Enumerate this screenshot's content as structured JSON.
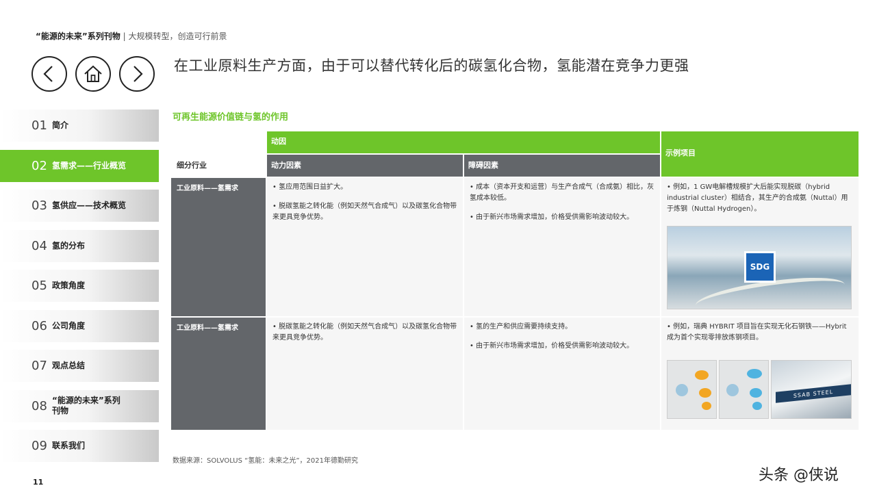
{
  "header": {
    "series_title": "“能源的未来”系列刊物",
    "series_subtitle": "| 大规模转型，创造可行前景",
    "headline": "在工业原料生产方面，由于可以替代转化后的碳氢化合物，氢能潜在竞争力更强"
  },
  "nav": {
    "back_icon": "chevron-left-icon",
    "home_icon": "home-icon",
    "forward_icon": "chevron-right-icon"
  },
  "sidebar": {
    "items": [
      {
        "num": "01",
        "label": "简介",
        "active": false
      },
      {
        "num": "02",
        "label": "氢需求——行业概览",
        "active": true
      },
      {
        "num": "03",
        "label": "氢供应——技术概览",
        "active": false
      },
      {
        "num": "04",
        "label": "氢的分布",
        "active": false
      },
      {
        "num": "05",
        "label": "政策角度",
        "active": false
      },
      {
        "num": "06",
        "label": "公司角度",
        "active": false
      },
      {
        "num": "07",
        "label": "观点总结",
        "active": false
      },
      {
        "num": "08",
        "label": "“能源的未来”系列刊物",
        "active": false
      },
      {
        "num": "09",
        "label": "联系我们",
        "active": false
      }
    ]
  },
  "page_number": "11",
  "table": {
    "title": "可再生能源价值链与氢的作用",
    "header_group": "动因",
    "header_case": "示例项目",
    "header_segment": "细分行业",
    "header_driver": "动力因素",
    "header_obstacle": "障碍因素",
    "rows": [
      {
        "segment": "工业原料——氢需求",
        "drivers": [
          "氢应用范围日益扩大。",
          "脱碳氢能之转化能（例如天然气合成气）以及碳氢化合物带来更具竞争优势。"
        ],
        "obstacles": [
          "成本（资本开支和运营）与生产合成气（合成氨）相比，灰氢成本较低。",
          "由于新兴市场需求增加，价格受供需影响波动较大。"
        ],
        "case": "例如，1 GW电解槽规模扩大后能实现脱碳（hybrid industrial cluster）相结合，其生产的合成氨（Nuttal）用于炼钢（Nuttal Hydrogen）。"
      },
      {
        "segment": "工业原料——氢需求",
        "drivers": [
          "脱碳氢能之转化能（例如天然气合成气）以及碳氢化合物带来更具竞争优势。"
        ],
        "obstacles": [
          "氢的生产和供应需要持续支持。",
          "由于新兴市场需求增加，价格受供需影响波动较大。"
        ],
        "case": "例如，瑞典 HYBRIT 项目旨在实现无化石钢铁——Hybrit 成为首个实现零排放炼钢项目。"
      }
    ]
  },
  "images": {
    "port_logo_text": "SDG",
    "steel_sign_text": "SSAB STEEL"
  },
  "source": "数据来源：SOLVOLUS “氢能：未来之光”，2021年德勤研究",
  "watermark": "头条 @侠说"
}
